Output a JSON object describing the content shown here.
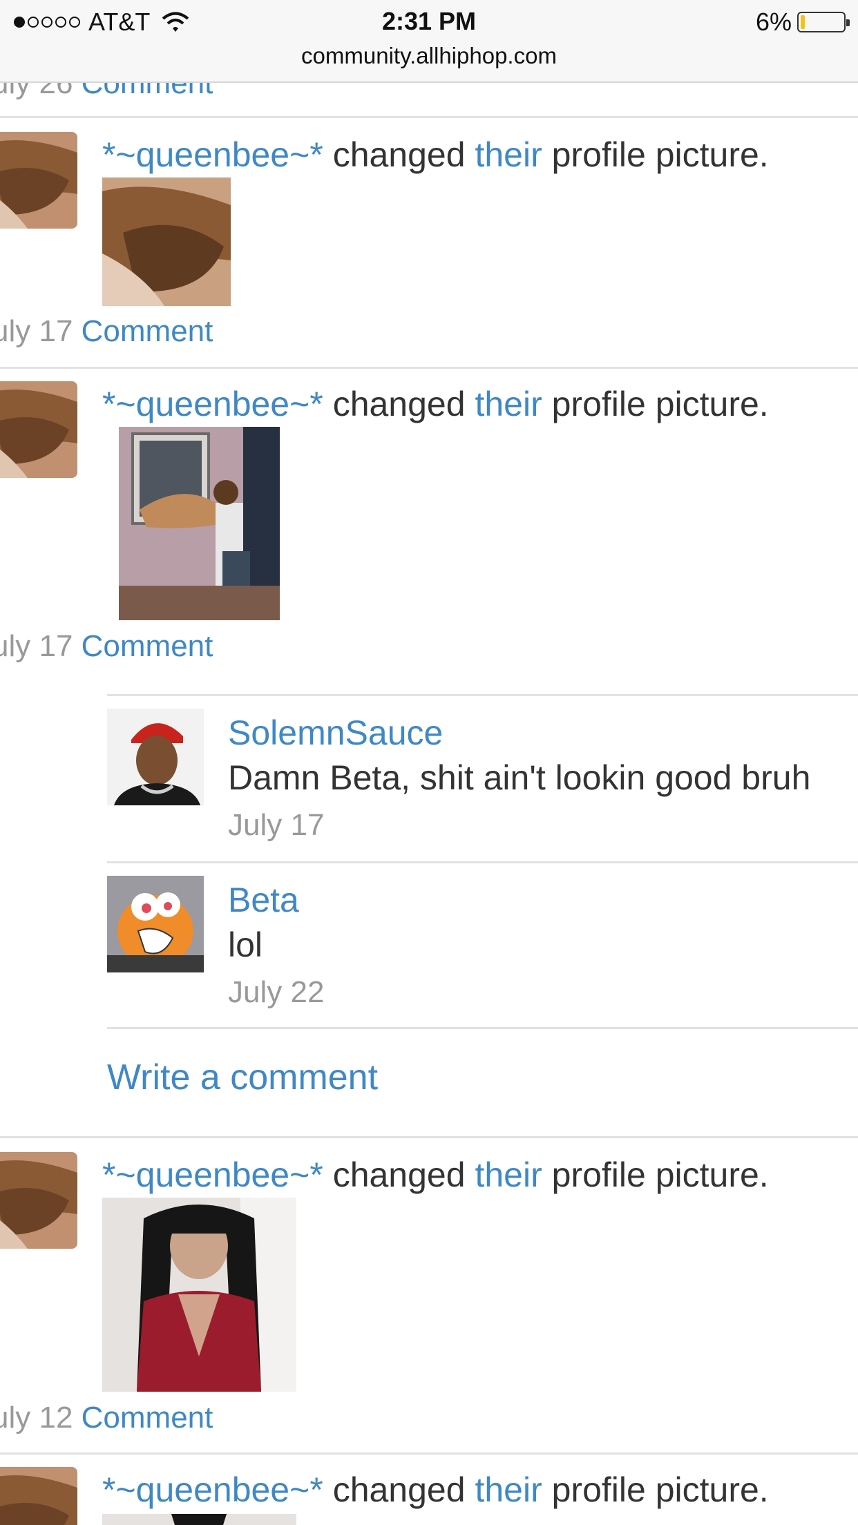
{
  "status_bar": {
    "carrier": "AT&T",
    "time": "2:31 PM",
    "battery": "6%",
    "battery_level": 0.06,
    "signal_bars": 1
  },
  "browser": {
    "url": "community.allhiphop.com"
  },
  "feed": {
    "top_clipped": {
      "date": "uly 26",
      "comment_label": "Comment"
    },
    "activities": [
      {
        "user": "*~queenbee~*",
        "verb": "changed",
        "pronoun": "their",
        "rest": "profile picture.",
        "date": "uly 17",
        "comment_label": "Comment"
      },
      {
        "user": "*~queenbee~*",
        "verb": "changed",
        "pronoun": "their",
        "rest": "profile picture.",
        "date": "uly 17",
        "comment_label": "Comment"
      },
      {
        "user": "*~queenbee~*",
        "verb": "changed",
        "pronoun": "their",
        "rest": "profile picture.",
        "date": "uly 12",
        "comment_label": "Comment"
      },
      {
        "user": "*~queenbee~*",
        "verb": "changed",
        "pronoun": "their",
        "rest": "profile picture."
      }
    ],
    "comments": [
      {
        "author": "SolemnSauce",
        "text": "Damn Beta, shit ain't lookin good bruh",
        "date": "July 17"
      },
      {
        "author": "Beta",
        "text": "lol",
        "date": "July 22"
      }
    ],
    "write_comment_label": "Write a comment"
  },
  "colors": {
    "link": "#3f88c5",
    "muted": "#999999",
    "text": "#333333",
    "divider": "#e2e2e2"
  }
}
